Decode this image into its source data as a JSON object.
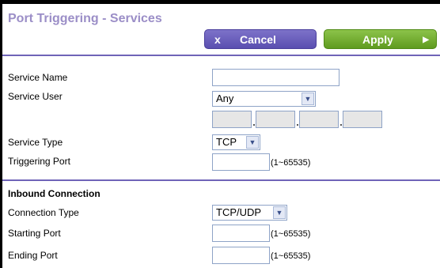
{
  "title": "Port Triggering - Services",
  "buttons": {
    "cancel_label": "Cancel",
    "apply_label": "Apply",
    "cancel_icon": "x",
    "apply_icon": "▶"
  },
  "form": {
    "service_name_label": "Service Name",
    "service_name_value": "",
    "service_user_label": "Service User",
    "service_user_value": "Any",
    "service_type_label": "Service Type",
    "service_type_value": "TCP",
    "triggering_port_label": "Triggering Port",
    "triggering_port_range": "(1~65535)"
  },
  "inbound": {
    "heading": "Inbound Connection",
    "connection_type_label": "Connection Type",
    "connection_type_value": "TCP/UDP",
    "starting_port_label": "Starting Port",
    "starting_port_range": "(1~65535)",
    "ending_port_label": "Ending Port",
    "ending_port_range": "(1~65535)"
  },
  "colors": {
    "title": "#9b8ec7",
    "cancel": "#6a5fbe",
    "apply": "#76b033",
    "rule": "#6f64b8"
  }
}
